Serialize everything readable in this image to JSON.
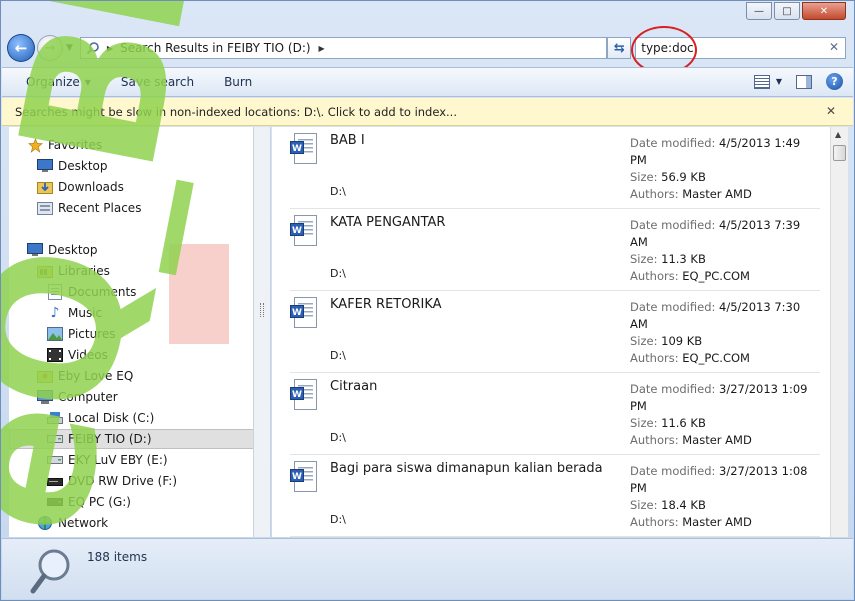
{
  "window": {
    "minimize_glyph": "—",
    "maximize_glyph": "□",
    "close_glyph": "✕"
  },
  "address": {
    "breadcrumb": "Search Results in FEIBY TIO (D:)",
    "search_value": "type:doc"
  },
  "toolbar": {
    "organize": "Organize",
    "save_search": "Save search",
    "burn": "Burn"
  },
  "infobar": {
    "message": "Searches might be slow in non-indexed locations: D:\\. Click to add to index..."
  },
  "nav": {
    "items": [
      {
        "label": "Favorites",
        "icon": "star-icon"
      },
      {
        "label": "Desktop",
        "icon": "desktop-icon"
      },
      {
        "label": "Downloads",
        "icon": "downloads-icon"
      },
      {
        "label": "Recent Places",
        "icon": "recent-places-icon"
      },
      {
        "label": "Desktop",
        "icon": "desktop-icon"
      },
      {
        "label": "Libraries",
        "icon": "libraries-icon"
      },
      {
        "label": "Documents",
        "icon": "documents-icon"
      },
      {
        "label": "Music",
        "icon": "music-icon"
      },
      {
        "label": "Pictures",
        "icon": "pictures-icon"
      },
      {
        "label": "Videos",
        "icon": "videos-icon"
      },
      {
        "label": "Eby Love EQ",
        "icon": "user-folder-icon"
      },
      {
        "label": "Computer",
        "icon": "computer-icon"
      },
      {
        "label": "Local Disk (C:)",
        "icon": "local-disk-icon"
      },
      {
        "label": "FEIBY TIO (D:)",
        "icon": "drive-icon"
      },
      {
        "label": "EKY LuV EBY (E:)",
        "icon": "drive-icon"
      },
      {
        "label": "DVD RW Drive (F:)",
        "icon": "dvd-drive-icon"
      },
      {
        "label": "EQ PC (G:)",
        "icon": "drive-icon"
      },
      {
        "label": "Network",
        "icon": "network-icon"
      }
    ]
  },
  "files": [
    {
      "name": "BAB I",
      "path": "D:\\",
      "date_label": "Date modified:",
      "date": "4/5/2013 1:49 PM",
      "size_label": "Size:",
      "size": "56.9 KB",
      "authors_label": "Authors:",
      "authors": "Master AMD"
    },
    {
      "name": "KATA PENGANTAR",
      "path": "D:\\",
      "date_label": "Date modified:",
      "date": "4/5/2013 7:39 AM",
      "size_label": "Size:",
      "size": "11.3 KB",
      "authors_label": "Authors:",
      "authors": "EQ_PC.COM"
    },
    {
      "name": "KAFER RETORIKA",
      "path": "D:\\",
      "date_label": "Date modified:",
      "date": "4/5/2013 7:30 AM",
      "size_label": "Size:",
      "size": "109 KB",
      "authors_label": "Authors:",
      "authors": "EQ_PC.COM"
    },
    {
      "name": "Citraan",
      "path": "D:\\",
      "date_label": "Date modified:",
      "date": "3/27/2013 1:09 PM",
      "size_label": "Size:",
      "size": "11.6 KB",
      "authors_label": "Authors:",
      "authors": "Master AMD"
    },
    {
      "name": "Bagi para siswa dimanapun kalian berada",
      "path": "D:\\",
      "date_label": "Date modified:",
      "date": "3/27/2013 1:08 PM",
      "size_label": "Size:",
      "size": "18.4 KB",
      "authors_label": "Authors:",
      "authors": "Master AMD"
    }
  ],
  "status": {
    "item_count": "188 items"
  },
  "colors": {
    "watermark": "#8fd24f",
    "highlight_ring": "#d82020"
  },
  "watermark_text": "eQ_Blog-Hijau"
}
